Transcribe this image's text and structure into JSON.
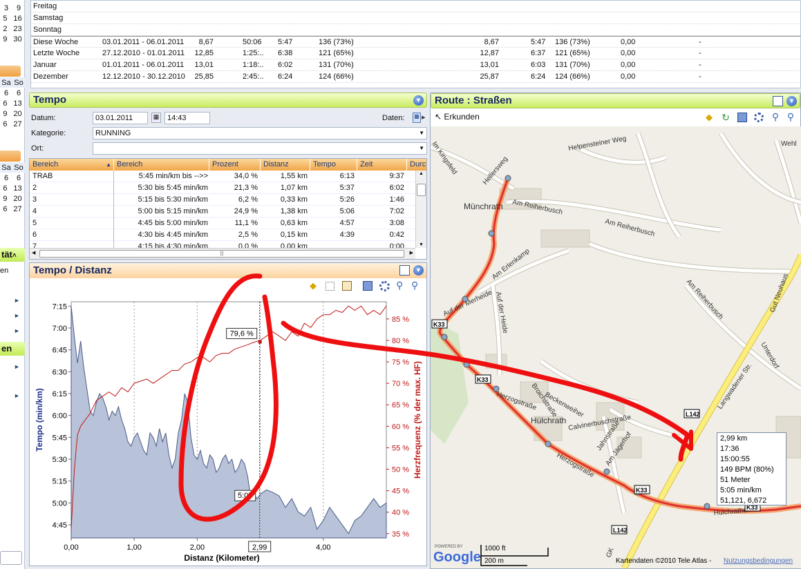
{
  "sidebar": {
    "cal_top": [
      [
        "3",
        "9"
      ],
      [
        "5",
        "16"
      ],
      [
        "2",
        "23"
      ],
      [
        "9",
        "30"
      ]
    ],
    "cal_mid_head": [
      "Sa",
      "So"
    ],
    "cal_mid": [
      [
        "6",
        "6"
      ],
      [
        "6",
        "13"
      ],
      [
        "9",
        "20"
      ],
      [
        "6",
        "27"
      ]
    ],
    "cal_low_head": [
      "Sa",
      "So"
    ],
    "cal_low": [
      [
        "6",
        "6"
      ],
      [
        "6",
        "13"
      ],
      [
        "9",
        "20"
      ],
      [
        "6",
        "27"
      ]
    ],
    "section1": "tät",
    "section1_sub": "en",
    "section2": "en"
  },
  "summary": {
    "rows": [
      {
        "label": "Freitag",
        "range": "",
        "a": "",
        "b": "",
        "c": "",
        "d": "",
        "e": "",
        "f": "",
        "g": "",
        "h": "",
        "i": ""
      },
      {
        "label": "Samstag",
        "range": "",
        "a": "",
        "b": "",
        "c": "",
        "d": "",
        "e": "",
        "f": "",
        "g": "",
        "h": "",
        "i": ""
      },
      {
        "label": "Sonntag",
        "range": "",
        "a": "",
        "b": "",
        "c": "",
        "d": "",
        "e": "",
        "f": "",
        "g": "",
        "h": "",
        "i": ""
      },
      {
        "label": "Diese Woche",
        "range": "03.01.2011 - 06.01.2011",
        "a": "8,67",
        "b": "50:06",
        "c": "5:47",
        "d": "136 (73%)",
        "e": "8,67",
        "f": "5:47",
        "g": "136 (73%)",
        "h": "0,00",
        "i": "-"
      },
      {
        "label": "Letzte Woche",
        "range": "27.12.2010 - 01.01.2011",
        "a": "12,85",
        "b": "1:25:..",
        "c": "6:38",
        "d": "121 (65%)",
        "e": "12,87",
        "f": "6:37",
        "g": "121 (65%)",
        "h": "0,00",
        "i": "-"
      },
      {
        "label": "Januar",
        "range": "01.01.2011 - 06.01.2011",
        "a": "13,01",
        "b": "1:18:..",
        "c": "6:02",
        "d": "131 (70%)",
        "e": "13,01",
        "f": "6:03",
        "g": "131 (70%)",
        "h": "0,00",
        "i": "-"
      },
      {
        "label": "Dezember",
        "range": "12.12.2010 - 30.12.2010",
        "a": "25,85",
        "b": "2:45:..",
        "c": "6:24",
        "d": "124 (66%)",
        "e": "25,87",
        "f": "6:24",
        "g": "124 (66%)",
        "h": "0,00",
        "i": "-"
      }
    ]
  },
  "tempo": {
    "title": "Tempo",
    "datum_label": "Datum:",
    "datum_value": "03.01.2011",
    "time_value": "14:43",
    "daten_label": "Daten:",
    "kategorie_label": "Kategorie:",
    "kategorie_value": "RUNNING",
    "ort_label": "Ort:",
    "ort_value": "",
    "columns": [
      "Bereich",
      "Bereich",
      "Prozent",
      "Distanz",
      "Tempo",
      "Zeit",
      "Durc"
    ],
    "rows": [
      [
        "TRAB",
        "5:45 min/km bis -->>",
        "34,0 %",
        "1,55 km",
        "6:13",
        "9:37"
      ],
      [
        "2",
        "5:30 bis 5:45 min/km",
        "21,3 %",
        "1,07 km",
        "5:37",
        "6:02"
      ],
      [
        "3",
        "5:15 bis 5:30 min/km",
        "6,2 %",
        "0,33 km",
        "5:26",
        "1:46"
      ],
      [
        "4",
        "5:00 bis 5:15 min/km",
        "24,9 %",
        "1,38 km",
        "5:06",
        "7:02"
      ],
      [
        "5",
        "4:45 bis 5:00 min/km",
        "11,1 %",
        "0,63 km",
        "4:57",
        "3:08"
      ],
      [
        "6",
        "4:30 bis 4:45 min/km",
        "2,5 %",
        "0,15 km",
        "4:39",
        "0:42"
      ],
      [
        "7",
        "4:15 bis 4:30 min/km",
        "0,0 %",
        "0,00 km",
        "",
        "0:00"
      ]
    ]
  },
  "chart_panel": {
    "title": "Tempo / Distanz"
  },
  "chart_data": {
    "type": "area",
    "xlabel": "Distanz (Kilometer)",
    "ylabel": "Tempo (min/km)",
    "y2label": "Herzfrequenz (% der max. HF)",
    "x_ticks": [
      "0,00",
      "1,00",
      "2,00",
      "4,00"
    ],
    "x_range": [
      0,
      5.0
    ],
    "y_ticks": [
      "7:15",
      "7:00",
      "6:45",
      "6:30",
      "6:15",
      "6:00",
      "5:45",
      "5:30",
      "5:15",
      "5:00",
      "4:45"
    ],
    "y_range_min": [
      4.6,
      7.3
    ],
    "y2_ticks": [
      "85 %",
      "80 %",
      "75 %",
      "70 %",
      "65 %",
      "60 %",
      "55 %",
      "50 %",
      "45 %",
      "40 %",
      "35 %"
    ],
    "y2_range": [
      34,
      89
    ],
    "cursor_x_label": "2,99",
    "cursor_hr_label": "79,6 %",
    "cursor_pace_label": "5:05",
    "series": [
      {
        "name": "Tempo",
        "color": "#4a5a88",
        "fill": "#b8c2d8",
        "x": [
          0,
          0.05,
          0.1,
          0.15,
          0.2,
          0.25,
          0.3,
          0.35,
          0.4,
          0.45,
          0.5,
          0.55,
          0.6,
          0.65,
          0.7,
          0.75,
          0.8,
          0.85,
          0.9,
          0.95,
          1.0,
          1.05,
          1.1,
          1.15,
          1.2,
          1.25,
          1.3,
          1.35,
          1.4,
          1.45,
          1.5,
          1.55,
          1.6,
          1.65,
          1.7,
          1.75,
          1.8,
          1.85,
          1.9,
          1.95,
          2.0,
          2.05,
          2.1,
          2.15,
          2.2,
          2.25,
          2.3,
          2.35,
          2.4,
          2.45,
          2.5,
          2.55,
          2.6,
          2.65,
          2.7,
          2.75,
          2.8,
          2.85,
          2.9,
          2.95,
          3.0,
          3.1,
          3.2,
          3.3,
          3.4,
          3.5,
          3.6,
          3.7,
          3.8,
          3.9,
          4.0,
          4.1,
          4.2,
          4.3,
          4.4,
          4.5,
          4.6,
          4.7,
          4.8,
          4.9,
          5.0
        ],
        "y": [
          7.25,
          6.9,
          6.6,
          6.85,
          6.55,
          6.3,
          6.05,
          6.0,
          6.15,
          6.25,
          6.2,
          6.1,
          5.95,
          6.05,
          6.0,
          6.1,
          5.95,
          5.85,
          5.7,
          5.65,
          5.75,
          5.8,
          5.7,
          5.6,
          5.55,
          5.8,
          5.75,
          5.65,
          5.85,
          5.7,
          5.8,
          5.55,
          5.4,
          5.5,
          5.8,
          5.95,
          6.25,
          6.15,
          5.75,
          5.55,
          5.5,
          5.6,
          5.45,
          5.4,
          5.55,
          5.5,
          5.35,
          5.4,
          5.5,
          5.55,
          5.45,
          5.5,
          5.35,
          5.4,
          5.5,
          5.45,
          5.3,
          5.05,
          5.1,
          5.05,
          5.1,
          5.15,
          5.12,
          5.08,
          4.95,
          5.05,
          4.9,
          4.85,
          4.95,
          4.7,
          4.8,
          4.95,
          4.85,
          4.75,
          4.65,
          4.8,
          4.85,
          4.95,
          5.05,
          4.95,
          5.0
        ]
      },
      {
        "name": "Herzfrequenz",
        "color": "#c01818",
        "x": [
          0,
          0.05,
          0.1,
          0.15,
          0.2,
          0.3,
          0.4,
          0.5,
          0.6,
          0.7,
          0.8,
          0.9,
          1.0,
          1.1,
          1.2,
          1.3,
          1.4,
          1.5,
          1.6,
          1.7,
          1.8,
          1.9,
          2.0,
          2.1,
          2.2,
          2.3,
          2.4,
          2.5,
          2.6,
          2.7,
          2.8,
          2.9,
          3.0,
          3.1,
          3.2,
          3.3,
          3.4,
          3.5,
          3.6,
          3.7,
          3.8,
          3.9,
          4.0,
          4.1,
          4.2,
          4.3,
          4.4,
          4.5,
          4.6,
          4.7,
          4.8,
          4.9,
          5.0
        ],
        "y": [
          36,
          50,
          58,
          60,
          61,
          63,
          66,
          67,
          68,
          67,
          69,
          68,
          70,
          70.5,
          71,
          70,
          71,
          72,
          73,
          73,
          74.5,
          75,
          76,
          76,
          75,
          76.5,
          77,
          77,
          78,
          78.5,
          79,
          79.6,
          80,
          81,
          82,
          81,
          80,
          82,
          81,
          84,
          83,
          85,
          86,
          86,
          87,
          86.5,
          88,
          87,
          88,
          86,
          87,
          86,
          88
        ]
      }
    ]
  },
  "route": {
    "title": "Route : Straßen",
    "explore_label": "Erkunden",
    "tooltip": [
      "2,99 km",
      "17:36",
      "15:00:55",
      "149 BPM (80%)",
      "51 Meter",
      "5:05 min/km",
      "51,121, 6,672"
    ],
    "labels": {
      "wehl": "Wehl",
      "im_kingsfeld": "Im Kingsfeld",
      "helpensteiner": "Helpensteiner Weg",
      "hellersweg": "Hellersweg",
      "munchrath": "Münchrath",
      "am_reiherbusch1": "Am Reiherbusch",
      "am_reiherbusch2": "Am Reiherbusch",
      "am_reiherbusch3": "Am Reiherbusch",
      "am_erlenkamp": "Am Erlenkamp",
      "auf_der_heide": "Auf der Heide",
      "auf_der_merheide": "Auf der Merheide",
      "k33": "K33",
      "unterdorf": "Unterdorf",
      "gut_neuhaus": "Gut Neuhaus",
      "langwadener": "Langwadener Str.",
      "l142": "L142",
      "herzogstrasse": "Herzogstraße",
      "broichstrasse": "Broichstraße",
      "hulchrath": "Hülchrath",
      "calvinerbusch": "Calvinerbuschstraße",
      "jahnstrasse": "Jahnstraße",
      "herzogstrasse2": "Herzogstraße",
      "am_jagerhof": "Am Jägerhof",
      "hulchrathe": "Hülchrather",
      "beckenweiher": "Beckenweiher",
      "gk": "GK",
      "scale_ft": "1000 ft",
      "scale_m": "200 m",
      "copyright": "Kartendaten ©2010 Tele Atlas - ",
      "terms": "Nutzungsbedingungen",
      "powered": "POWERED BY",
      "google": "Google"
    }
  }
}
